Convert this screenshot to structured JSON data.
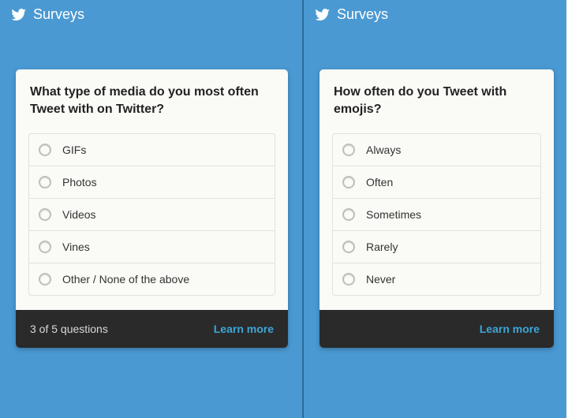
{
  "header": {
    "title": "Surveys"
  },
  "colors": {
    "bg": "#4a99d3",
    "footer": "#2a2a2a",
    "link": "#3da6d8"
  },
  "left": {
    "question": "What type of media do you most often Tweet with on Twitter?",
    "options": [
      "GIFs",
      "Photos",
      "Videos",
      "Vines",
      "Other / None of the above"
    ],
    "progress": "3 of 5 questions",
    "learn_more": "Learn more"
  },
  "right": {
    "question": "How often do you Tweet with emojis?",
    "options": [
      "Always",
      "Often",
      "Sometimes",
      "Rarely",
      "Never"
    ],
    "learn_more": "Learn more"
  }
}
